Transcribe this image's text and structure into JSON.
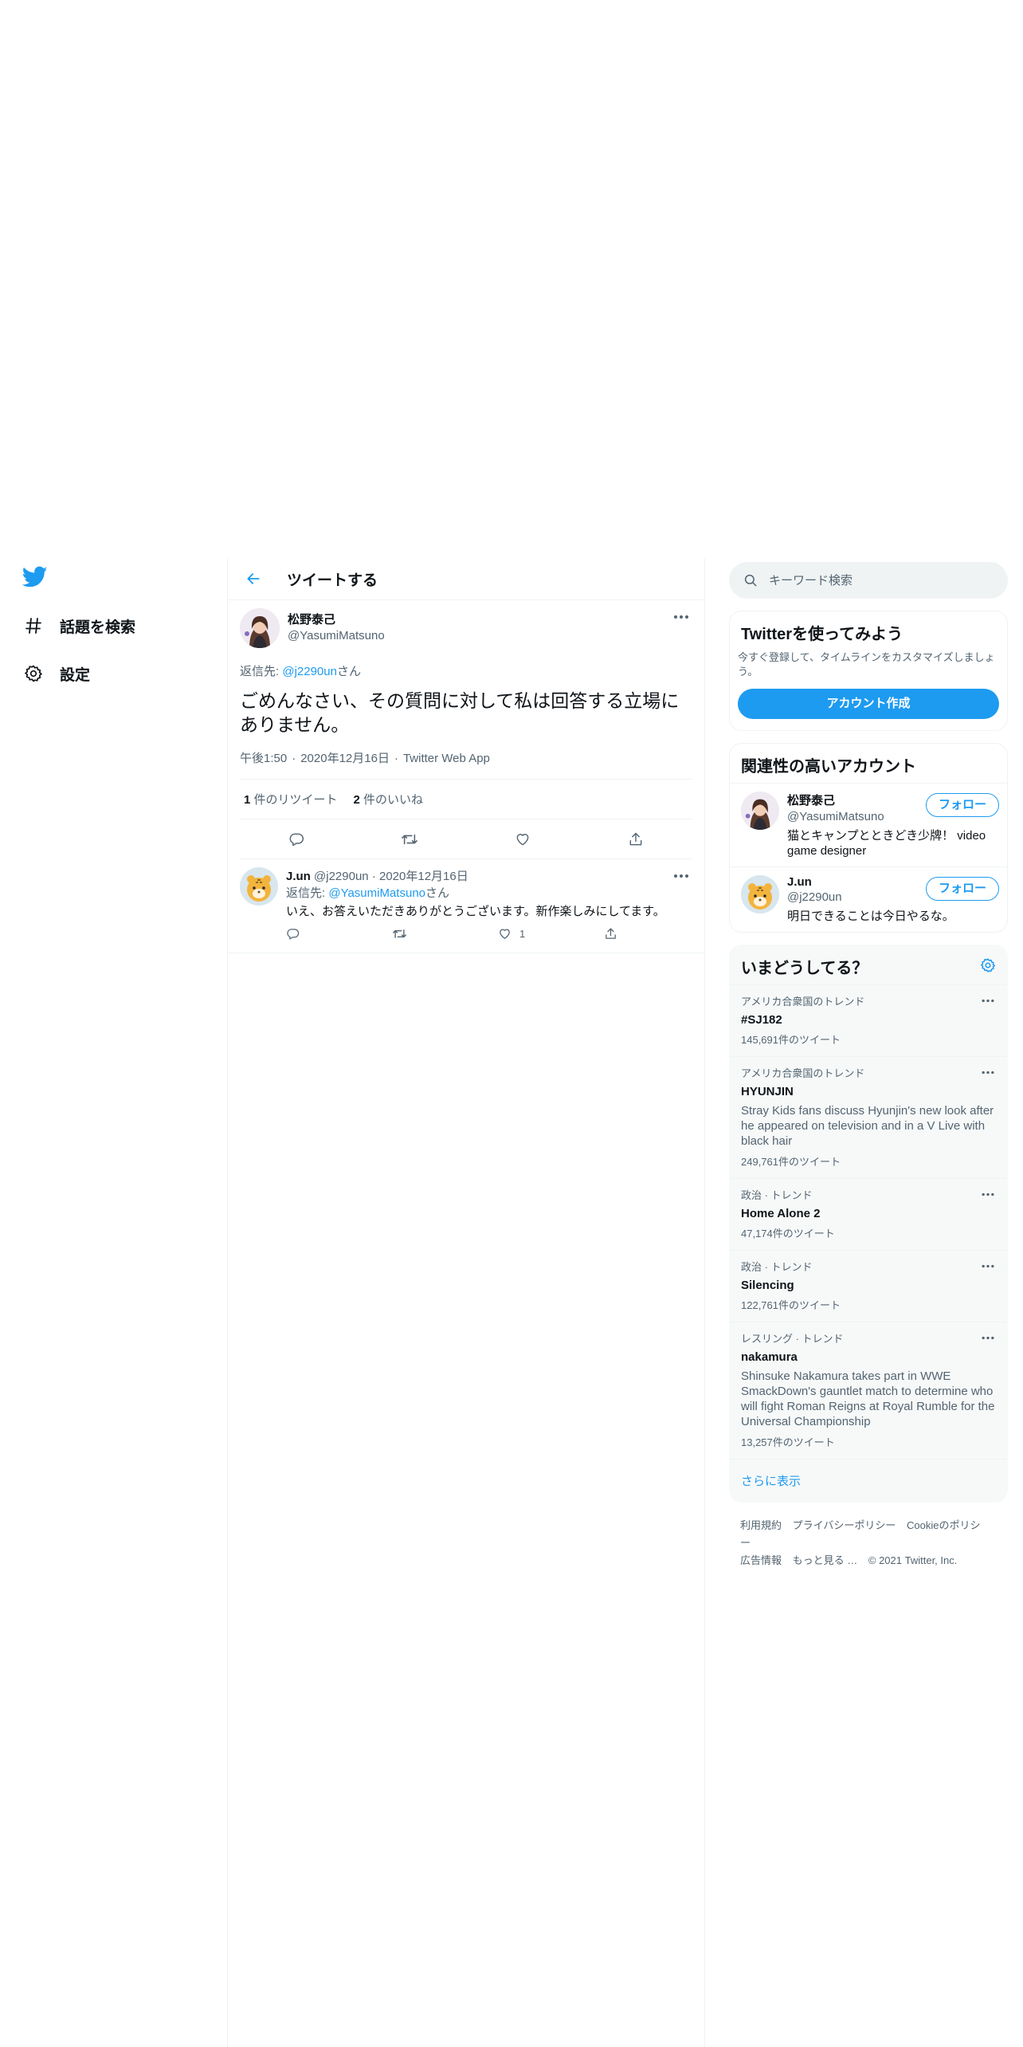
{
  "nav": {
    "logo": "twitter-bird-icon",
    "explore_label": "話題を検索",
    "settings_label": "設定"
  },
  "header": {
    "title": "ツイートする"
  },
  "tweet": {
    "display_name": "松野泰己",
    "handle": "@YasumiMatsuno",
    "reply_to_prefix": "返信先: ",
    "reply_to_handle": "@j2290un",
    "reply_to_suffix": "さん",
    "text": "ごめんなさい、その質問に対して私は回答する立場にありません。",
    "time": "午後1:50",
    "date": "2020年12月16日",
    "source": "Twitter Web App",
    "retweets_count": "1",
    "retweets_label": " 件のリツイート",
    "likes_count": "2",
    "likes_label": " 件のいいね"
  },
  "reply": {
    "display_name": "J.un",
    "handle": "@j2290un",
    "date": "2020年12月16日",
    "reply_to_prefix": "返信先: ",
    "reply_to_handle": "@YasumiMatsuno",
    "reply_to_suffix": "さん",
    "text": "いえ、お答えいただきありがとうございます。新作楽しみにしてます。",
    "like_count": "1"
  },
  "search": {
    "placeholder": "キーワード検索"
  },
  "signup": {
    "title": "Twitterを使ってみよう",
    "desc": "今すぐ登録して、タイムラインをカスタマイズしましょう。",
    "button": "アカウント作成"
  },
  "who_to_follow": {
    "title": "関連性の高いアカウント",
    "follow_label": "フォロー",
    "accounts": [
      {
        "name": "松野泰己",
        "handle": "@YasumiMatsuno",
        "bio": "猫とキャンプとときどき少牌！ video game designer"
      },
      {
        "name": "J.un",
        "handle": "@j2290un",
        "bio": "明日できることは今日やるな。"
      }
    ]
  },
  "trends": {
    "title": "いまどうしてる？",
    "items": [
      {
        "category": "アメリカ合衆国のトレンド",
        "name": "#SJ182",
        "desc": "",
        "count": "145,691件のツイート"
      },
      {
        "category": "アメリカ合衆国のトレンド",
        "name": "HYUNJIN",
        "desc": "Stray Kids fans discuss Hyunjin's new look after he appeared on television and in a V Live with black hair",
        "count": "249,761件のツイート"
      },
      {
        "category": "政治 · トレンド",
        "name": "Home Alone 2",
        "desc": "",
        "count": "47,174件のツイート"
      },
      {
        "category": "政治 · トレンド",
        "name": "Silencing",
        "desc": "",
        "count": "122,761件のツイート"
      },
      {
        "category": "レスリング · トレンド",
        "name": "nakamura",
        "desc": "Shinsuke Nakamura takes part in WWE SmackDown's gauntlet match to determine who will fight Roman Reigns at Royal Rumble for the Universal Championship",
        "count": "13,257件のツイート"
      }
    ],
    "show_more": "さらに表示"
  },
  "footer": {
    "terms": "利用規約",
    "privacy": "プライバシーポリシー",
    "cookies": "Cookieのポリシー",
    "ads": "広告情報",
    "more": "もっと見る …",
    "copyright": "© 2021 Twitter, Inc."
  },
  "colors": {
    "accent": "#1d9bf0",
    "text": "#0f1419",
    "secondary": "#536471",
    "border": "#eff3f4"
  }
}
